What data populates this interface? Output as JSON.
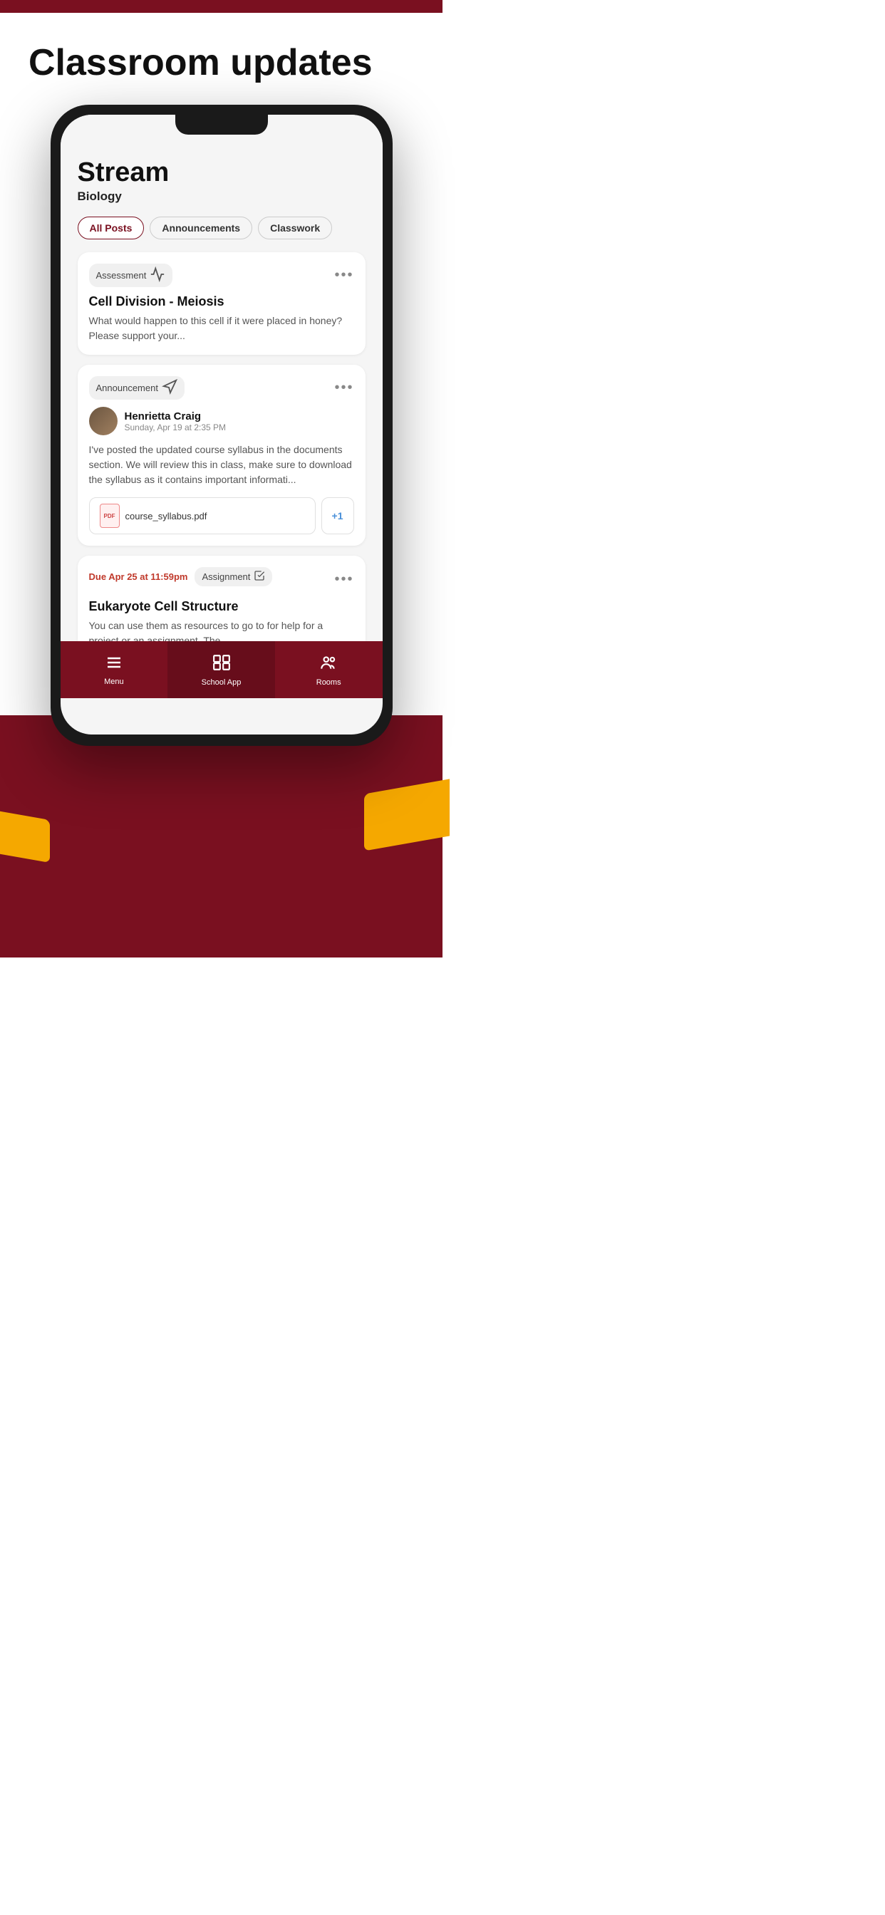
{
  "page": {
    "title": "Classroom updates"
  },
  "phone": {
    "screen": {
      "header": {
        "title": "Stream",
        "subtitle": "Biology"
      },
      "tabs": [
        {
          "label": "All Posts",
          "active": true
        },
        {
          "label": "Announcements",
          "active": false
        },
        {
          "label": "Classwork",
          "active": false
        }
      ],
      "cards": [
        {
          "type": "assessment",
          "badge": "Assessment",
          "title": "Cell Division - Meiosis",
          "body": "What would happen to this cell if it were placed in honey? Please support your..."
        },
        {
          "type": "announcement",
          "badge": "Announcement",
          "author_name": "Henrietta Craig",
          "author_date": "Sunday, Apr 19 at 2:35 PM",
          "body": "I've posted the updated course syllabus in the documents section. We will review this in class, make sure to download the syllabus as it contains important informati...",
          "attachment": "course_syllabus.pdf",
          "extra_count": "+1"
        },
        {
          "type": "assignment",
          "due_label": "Due Apr 25 at 11:59pm",
          "badge": "Assignment",
          "title": "Eukaryote Cell Structure",
          "body": "You can use them as resources to go to for help for a project or an assignment. The..."
        }
      ],
      "bottom_nav": [
        {
          "label": "Menu",
          "icon": "menu",
          "active": false
        },
        {
          "label": "School App",
          "icon": "school",
          "active": true
        },
        {
          "label": "Rooms",
          "icon": "rooms",
          "active": false
        }
      ]
    }
  }
}
